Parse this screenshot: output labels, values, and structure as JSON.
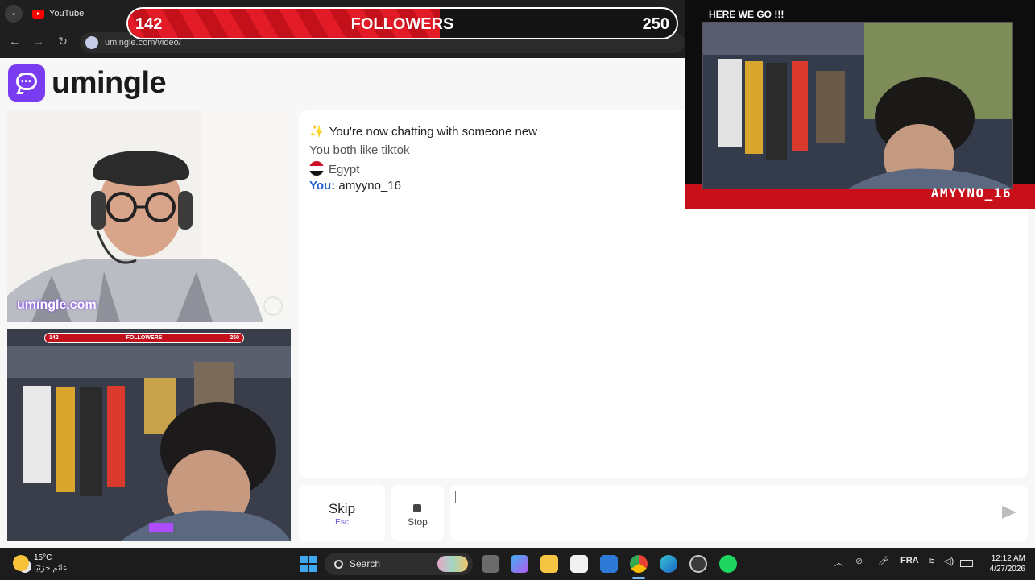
{
  "browser": {
    "tab_title": "YouTube",
    "url": "umingle.com/video/",
    "nav": {
      "back": "←",
      "forward": "→",
      "reload": "↻",
      "dropdown": "⌄"
    }
  },
  "followers_bar": {
    "current": "142",
    "title": "FOLLOWERS",
    "goal": "250",
    "progress": 0.568,
    "colors": {
      "fill": "#e21b27",
      "track": "#141414"
    }
  },
  "logo": {
    "text": "umingle",
    "icon": "chat-bubble-icon",
    "color": "#7a3cf0"
  },
  "cams": {
    "stranger_watermark": "umingle.com",
    "self_overlay": {
      "current": "142",
      "title": "FOLLOWERS",
      "goal": "250"
    }
  },
  "chat": {
    "intro_emoji": "✨",
    "intro": "You're now chatting with someone new",
    "common_interest": "You both like tiktok",
    "country": "Egypt",
    "you_label": "You:",
    "you_message": "amyyno_16"
  },
  "controls": {
    "skip_label": "Skip",
    "skip_shortcut": "Esc",
    "stop_label": "Stop",
    "send_icon": "send-icon"
  },
  "streamer_cam": {
    "hype_text": "HERE WE GO !!!",
    "name": "AMYYNO_16",
    "accent": "#c8101a"
  },
  "taskbar": {
    "weather_temp": "15°C",
    "weather_text": "غائم جزئيًا",
    "search_label": "Search",
    "language": "FRA",
    "time": "12:12 AM",
    "date": "4/27/2026"
  }
}
